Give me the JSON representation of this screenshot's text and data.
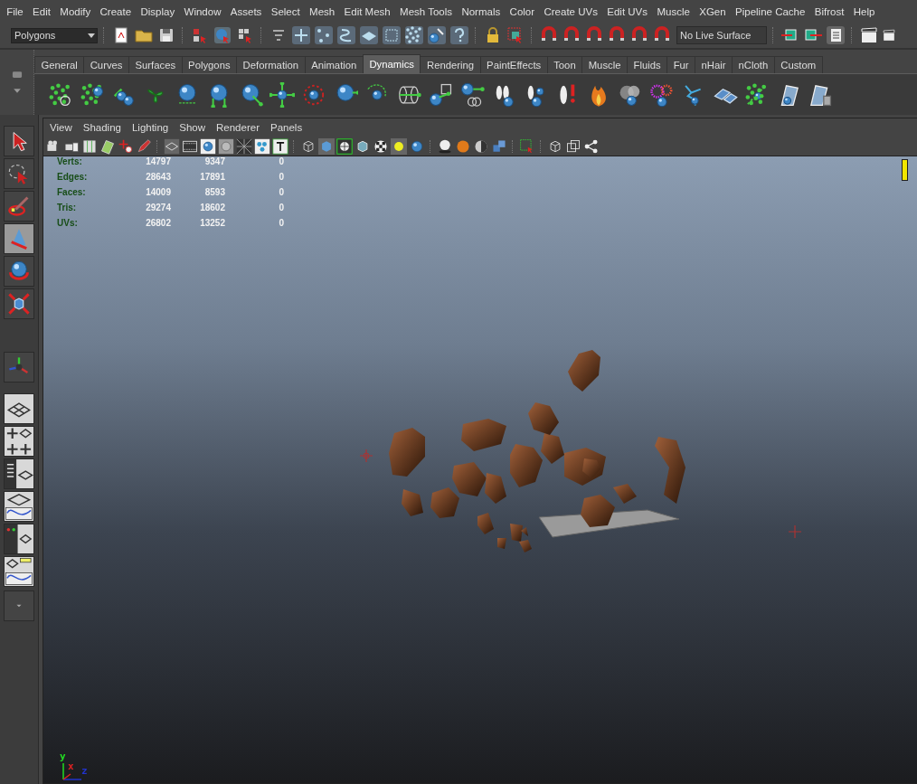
{
  "menu_bar": {
    "items": [
      "File",
      "Edit",
      "Modify",
      "Create",
      "Display",
      "Window",
      "Assets",
      "Select",
      "Mesh",
      "Edit Mesh",
      "Mesh Tools",
      "Normals",
      "Color",
      "Create UVs",
      "Edit UVs",
      "Muscle",
      "XGen",
      "Pipeline Cache",
      "Bifrost",
      "Help"
    ]
  },
  "status_line": {
    "mode_menu": {
      "value": "Polygons"
    },
    "live_surface": {
      "value": "No Live Surface"
    }
  },
  "shelf": {
    "tabs": [
      {
        "label": "General",
        "selected": false
      },
      {
        "label": "Curves",
        "selected": false
      },
      {
        "label": "Surfaces",
        "selected": false
      },
      {
        "label": "Polygons",
        "selected": false
      },
      {
        "label": "Deformation",
        "selected": false
      },
      {
        "label": "Animation",
        "selected": false
      },
      {
        "label": "Dynamics",
        "selected": true
      },
      {
        "label": "Rendering",
        "selected": false
      },
      {
        "label": "PaintEffects",
        "selected": false
      },
      {
        "label": "Toon",
        "selected": false
      },
      {
        "label": "Muscle",
        "selected": false
      },
      {
        "label": "Fluids",
        "selected": false
      },
      {
        "label": "Fur",
        "selected": false
      },
      {
        "label": "nHair",
        "selected": false
      },
      {
        "label": "nCloth",
        "selected": false
      },
      {
        "label": "Custom",
        "selected": false
      }
    ]
  },
  "toolbox": {
    "tools": [
      {
        "selected": false
      },
      {
        "selected": false
      },
      {
        "selected": false
      },
      {
        "selected": true
      },
      {
        "selected": false
      },
      {
        "selected": false
      }
    ]
  },
  "viewport": {
    "menu": [
      "View",
      "Shading",
      "Lighting",
      "Show",
      "Renderer",
      "Panels"
    ],
    "hud": {
      "rows": [
        {
          "label": "Verts:",
          "values": [
            "14797",
            "9347",
            "0"
          ]
        },
        {
          "label": "Edges:",
          "values": [
            "28643",
            "17891",
            "0"
          ]
        },
        {
          "label": "Faces:",
          "values": [
            "14009",
            "8593",
            "0"
          ]
        },
        {
          "label": "Tris:",
          "values": [
            "29274",
            "18602",
            "0"
          ]
        },
        {
          "label": "UVs:",
          "values": [
            "26802",
            "13252",
            "0"
          ]
        }
      ]
    },
    "axis": {
      "y": "y",
      "x": "x",
      "z": "z"
    }
  }
}
